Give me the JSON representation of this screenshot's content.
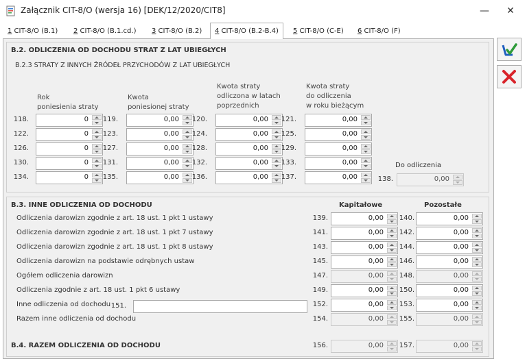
{
  "window": {
    "title": "Załącznik CIT-8/O (wersja 16) [DEK/12/2020/CIT8]",
    "minimize": "—",
    "close": "✕"
  },
  "tabs": [
    {
      "key": "1",
      "label": " CIT-8/O (B.1)"
    },
    {
      "key": "2",
      "label": " CIT-8/O (B.1.cd.)"
    },
    {
      "key": "3",
      "label": " CIT-8/O (B.2)"
    },
    {
      "key": "4",
      "label": " CIT-8/O (B.2-B.4)"
    },
    {
      "key": "5",
      "label": " CIT-8/O (C-E)"
    },
    {
      "key": "6",
      "label": " CIT-8/O (F)"
    }
  ],
  "b2": {
    "title": "B.2. ODLICZENIA OD DOCHODU STRAT Z LAT UBIEGŁYCH",
    "subtitle": "B.2.3 STRATY Z INNYCH ŹRÓDEŁ PRZYCHODÓW Z LAT UBIEGŁYCH",
    "col1": [
      "Rok",
      "poniesienia straty"
    ],
    "col2": [
      "Kwota",
      "poniesionej straty"
    ],
    "col3": [
      "Kwota straty",
      "odliczona w latach",
      "poprzednich"
    ],
    "col4": [
      "Kwota straty",
      "do odliczenia",
      "w roku bieżącym"
    ],
    "rows": [
      {
        "n1": "118.",
        "v1": "0",
        "n2": "119.",
        "v2": "0,00",
        "n3": "120.",
        "v3": "0,00",
        "n4": "121.",
        "v4": "0,00"
      },
      {
        "n1": "122.",
        "v1": "0",
        "n2": "123.",
        "v2": "0,00",
        "n3": "124.",
        "v3": "0,00",
        "n4": "125.",
        "v4": "0,00"
      },
      {
        "n1": "126.",
        "v1": "0",
        "n2": "127.",
        "v2": "0,00",
        "n3": "128.",
        "v3": "0,00",
        "n4": "129.",
        "v4": "0,00"
      },
      {
        "n1": "130.",
        "v1": "0",
        "n2": "131.",
        "v2": "0,00",
        "n3": "132.",
        "v3": "0,00",
        "n4": "133.",
        "v4": "0,00"
      },
      {
        "n1": "134.",
        "v1": "0",
        "n2": "135.",
        "v2": "0,00",
        "n3": "136.",
        "v3": "0,00",
        "n4": "137.",
        "v4": "0,00"
      }
    ],
    "do_odliczenia_label": "Do odliczenia",
    "do_odliczenia_num": "138.",
    "do_odliczenia_val": "0,00"
  },
  "b3": {
    "title": "B.3. INNE ODLICZENIA OD DOCHODU",
    "head_kap": "Kapitałowe",
    "head_poz": "Pozostałe",
    "rows": [
      {
        "label": "Odliczenia darowizn zgodnie z art. 18 ust. 1 pkt 1 ustawy",
        "nk": "139.",
        "vk": "0,00",
        "np": "140.",
        "vp": "0,00",
        "ro": false
      },
      {
        "label": "Odliczenia darowizn zgodnie z art. 18 ust. 1 pkt 7 ustawy",
        "nk": "141.",
        "vk": "0,00",
        "np": "142.",
        "vp": "0,00",
        "ro": false
      },
      {
        "label": "Odliczenia darowizn zgodnie z art. 18 ust. 1 pkt 8 ustawy",
        "nk": "143.",
        "vk": "0,00",
        "np": "144.",
        "vp": "0,00",
        "ro": false
      },
      {
        "label": "Odliczenia darowizn na podstawie odrębnych ustaw",
        "nk": "145.",
        "vk": "0,00",
        "np": "146.",
        "vp": "0,00",
        "ro": false
      },
      {
        "label": "Ogółem odliczenia darowizn",
        "nk": "147.",
        "vk": "0,00",
        "np": "148.",
        "vp": "0,00",
        "ro": true
      },
      {
        "label": "Odliczenia zgodnie z art. 18 ust. 1 pkt 6 ustawy",
        "nk": "149.",
        "vk": "0,00",
        "np": "150.",
        "vp": "0,00",
        "ro": false
      },
      {
        "label": "Inne odliczenia od dochodu",
        "nk": "152.",
        "vk": "0,00",
        "np": "153.",
        "vp": "0,00",
        "ro": false
      },
      {
        "label": "Razem inne odliczenia od dochodu",
        "nk": "154.",
        "vk": "0,00",
        "np": "155.",
        "vp": "0,00",
        "ro": true
      }
    ],
    "other_num": "151.",
    "other_value": ""
  },
  "b4": {
    "title": "B.4. RAZEM ODLICZENIA OD DOCHODU",
    "nk": "156.",
    "vk": "0,00",
    "np": "157.",
    "vp": "0,00"
  },
  "icons": {
    "save": "save-check-icon",
    "cancel": "close-x-icon"
  },
  "colors": {
    "save_blue": "#1f5fbf",
    "save_green": "#2e9b3a",
    "cancel_red": "#d9232a"
  }
}
